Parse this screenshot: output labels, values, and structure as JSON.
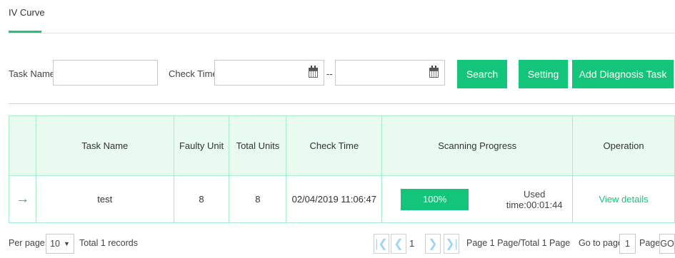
{
  "tabs": {
    "active": "IV Curve"
  },
  "filters": {
    "task_name_label": "Task Name",
    "task_name_value": "",
    "check_time_label": "Check Time",
    "date_from": "",
    "date_separator": "--",
    "date_to": ""
  },
  "buttons": {
    "search": "Search",
    "setting": "Setting",
    "add_task": "Add Diagnosis Task"
  },
  "table": {
    "headers": [
      "",
      "Task Name",
      "Faulty Unit",
      "Total Units",
      "Check Time",
      "Scanning Progress",
      "Operation"
    ],
    "rows": [
      {
        "task_name": "test",
        "faulty_unit": "8",
        "total_units": "8",
        "check_time": "02/04/2019 11:06:47",
        "progress_label": "100%",
        "progress": 1.0,
        "used_time": "Used time:00:01:44",
        "operation": "View details"
      }
    ]
  },
  "pagination": {
    "per_page_label": "Per page:",
    "per_page_value": "10",
    "total": "Total 1 records",
    "current_page": "1",
    "summary": "Page 1 Page/Total 1 Page",
    "goto_label": "Go to page",
    "goto_value": "1",
    "page_label": "Page",
    "go_button": "GO"
  },
  "colors": {
    "accent": "#13c57a",
    "header_bg": "#e9fbf1",
    "border": "#a8ecc9",
    "faulty": "#e0382c",
    "pager_icon": "#9fd5f5"
  }
}
